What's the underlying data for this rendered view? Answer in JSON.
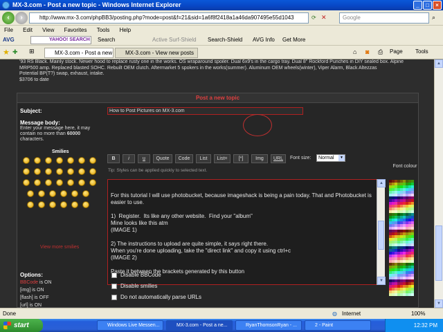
{
  "window": {
    "title": "MX-3.com - Post a new topic - Windows Internet Explorer"
  },
  "address": {
    "url": "http://www.mx-3.com/phpBB3/posting.php?mode=post&f=21&sid=1a6f8f2418a1a46da907495e55d1043",
    "search_placeholder": "Google"
  },
  "menu": [
    "File",
    "Edit",
    "View",
    "Favorites",
    "Tools",
    "Help"
  ],
  "toolbar": {
    "avg": "AVG",
    "yahoo": "YAHOO! SEARCH",
    "search": "Search",
    "active_shield": "Active Surf-Shield",
    "search_shield": "Search-Shield",
    "avg_info": "AVG Info",
    "get_more": "Get More"
  },
  "tabs": [
    {
      "label": "MX-3.com - Post a new to..."
    },
    {
      "label": "MX-3.com - View new posts"
    }
  ],
  "cmd": {
    "page": "Page",
    "tools": "Tools"
  },
  "signature": "'93 RS Black. Mainly stock. Newer hood to replace rusty one in the works. OS wraparound spoiler. Dual 6x9's in the cargo tray. Dual 8\" Rockford Punches in DIY sealed box. Alpine MRP500 amp. Replaced blasted SOHC. Rebuilt OEM clutch. Aftermarket 5 spokers in the works(summer). Aluminum OEM wheels(winter), Viper Alarm, Black Altezzas\nPotential BP(T?) swap, exhaust, intake.\n$3706 to date",
  "form": {
    "title": "Post a new topic",
    "subject_label": "Subject:",
    "subject_value": "How to Post Pictures on MX-3.com",
    "body_label": "Message body:",
    "body_help": "Enter your message here, it may contain no more than",
    "body_limit": "60000",
    "body_unit": "characters.",
    "smilies_label": "Smilies",
    "view_more": "View more smilies",
    "buttons": [
      "B",
      "i",
      "u",
      "Quote",
      "Code",
      "List",
      "List=",
      "[*]",
      "Img",
      "URL"
    ],
    "font_size_label": "Font size:",
    "font_size_value": "Normal",
    "tip": "Tip: Styles can be applied quickly to selected text.",
    "font_colour": "Font colour",
    "message": "For this tutorial I will use photobucket, because imageshack is being a pain today. That and Photobucket is easier to use.\n\n1)  Register.  Its like any other website.  Find your \"album\"\nMine looks like this atm\n(IMAGE 1)\n\n2) The instructions to upload are quite simple, it says right there.\nWhen you're done uploading, take the \"direct link\" and copy it using ctrl+c\n(IMAGE 2)\n\nPaste it between the brackets generated by this button"
  },
  "options": {
    "label": "Options:",
    "bbcode": "BBCode",
    "bbcode_state": "is ON",
    "img": "[img] is ON",
    "flash": "[flash] is OFF",
    "url": "[url] is ON",
    "checks": [
      "Disable BBCode",
      "Disable smilies",
      "Do not automatically parse URLs"
    ]
  },
  "status": {
    "left": "Done",
    "zone": "Internet",
    "zoom": "100%"
  },
  "taskbar": {
    "start": "start",
    "tasks": [
      "Windows Live Messen...",
      "MX-3.com - Post a ne...",
      "RyanThomsonRyan - ...",
      "2 - Paint"
    ],
    "time": "12:32 PM"
  }
}
